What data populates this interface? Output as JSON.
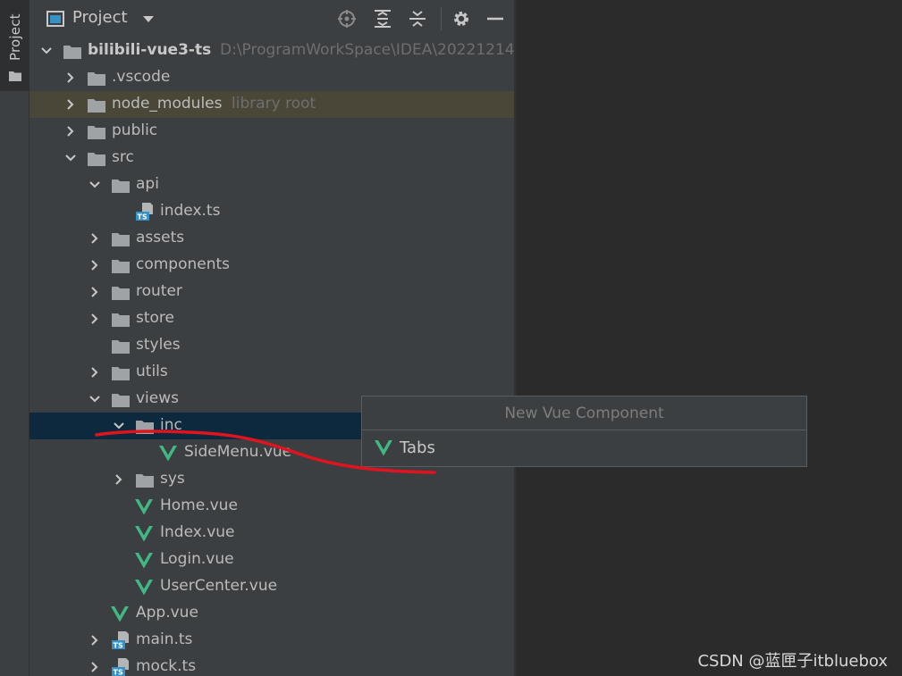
{
  "side_toolbar": {
    "tab_label": "Project",
    "icon": "folder-icon"
  },
  "panel": {
    "title": "Project",
    "header_icons": [
      "project-view-icon",
      "dropdown-caret-icon",
      "locate-icon",
      "expand-all-icon",
      "collapse-all-icon",
      "gear-icon",
      "minimize-icon"
    ]
  },
  "tree": [
    {
      "label": "bilibili-vue3-ts",
      "sub": "D:\\ProgramWorkSpace\\IDEA\\20221214",
      "icon": "folder-icon",
      "expanded": true,
      "bold": true
    },
    {
      "label": ".vscode",
      "icon": "folder-icon",
      "expanded": false
    },
    {
      "label": "node_modules",
      "sub": "library root",
      "icon": "folder-icon",
      "expanded": false,
      "highlight": "library"
    },
    {
      "label": "public",
      "icon": "folder-icon",
      "expanded": false
    },
    {
      "label": "src",
      "icon": "folder-icon",
      "expanded": true
    },
    {
      "label": "api",
      "icon": "folder-icon",
      "expanded": true
    },
    {
      "label": "index.ts",
      "icon": "typescript-file-icon"
    },
    {
      "label": "assets",
      "icon": "folder-icon",
      "expanded": false
    },
    {
      "label": "components",
      "icon": "folder-icon",
      "expanded": false
    },
    {
      "label": "router",
      "icon": "folder-icon",
      "expanded": false
    },
    {
      "label": "store",
      "icon": "folder-icon",
      "expanded": false
    },
    {
      "label": "styles",
      "icon": "folder-icon"
    },
    {
      "label": "utils",
      "icon": "folder-icon",
      "expanded": false
    },
    {
      "label": "views",
      "icon": "folder-icon",
      "expanded": true
    },
    {
      "label": "inc",
      "icon": "folder-icon",
      "expanded": true,
      "selected": true
    },
    {
      "label": "SideMenu.vue",
      "icon": "vue-file-icon"
    },
    {
      "label": "sys",
      "icon": "folder-icon",
      "expanded": false
    },
    {
      "label": "Home.vue",
      "icon": "vue-file-icon"
    },
    {
      "label": "Index.vue",
      "icon": "vue-file-icon"
    },
    {
      "label": "Login.vue",
      "icon": "vue-file-icon"
    },
    {
      "label": "UserCenter.vue",
      "icon": "vue-file-icon"
    },
    {
      "label": "App.vue",
      "icon": "vue-file-icon"
    },
    {
      "label": "main.ts",
      "icon": "typescript-file-icon",
      "expanded": false
    },
    {
      "label": "mock.ts",
      "icon": "typescript-file-icon",
      "expanded": false
    }
  ],
  "popup": {
    "title": "New Vue Component",
    "items": [
      {
        "label": "Tabs",
        "icon": "vue-icon"
      }
    ]
  },
  "watermark": "CSDN @蓝匣子itbluebox",
  "colors": {
    "panel_bg": "#3c3f41",
    "editor_bg": "#2b2b2b",
    "selected_row": "#0d293e",
    "library_row": "#4a4739",
    "vue_green": "#41b883",
    "annotation_red": "#e0141e"
  }
}
